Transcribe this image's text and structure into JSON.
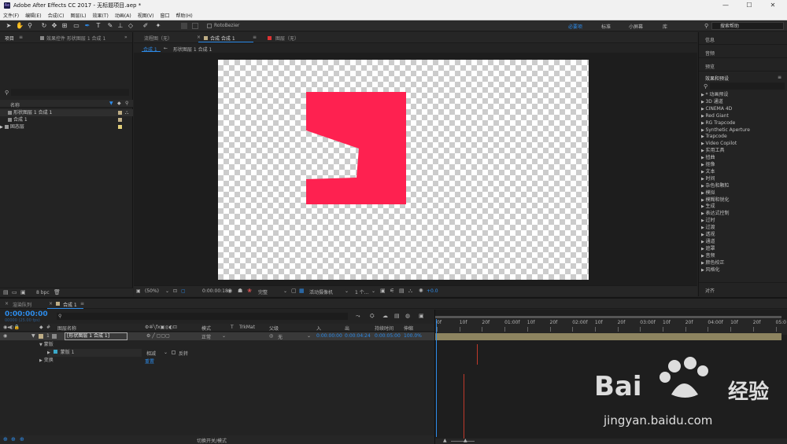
{
  "window": {
    "title": "Adobe After Effects CC 2017 - 无标题项目.aep *",
    "minimize": "—",
    "maximize": "☐",
    "close": "✕"
  },
  "menu": [
    "文件(F)",
    "编辑(E)",
    "合成(C)",
    "图层(L)",
    "效果(T)",
    "动画(A)",
    "视图(V)",
    "窗口",
    "帮助(H)"
  ],
  "toolbar": {
    "rotobezier": "RotoBezier",
    "workspaces": [
      "必要项",
      "标准",
      "小屏幕",
      "库"
    ],
    "search_placeholder": "搜索帮助"
  },
  "project": {
    "tab": "项目",
    "tab2": "效果控件 形状图层 1 合成 1",
    "col_name": "名称",
    "items": [
      "形状图层 1 合成 1",
      "合成 1",
      "固态层"
    ],
    "bpc": "8 bpc"
  },
  "viewer": {
    "tabs": [
      "流程图（无）",
      "合成 合成 1",
      "图层（无）"
    ],
    "breadcrumb": [
      "合成 1",
      "形状图层 1 合成 1"
    ],
    "zoom": "(50%)",
    "timecode": "0:00:00:18",
    "quality": "完整",
    "camera": "活动摄像机",
    "views": "1 个...",
    "exposure": "+0.0"
  },
  "right_panels": {
    "info": "信息",
    "audio": "音频",
    "preview": "预览",
    "effects": "效果和预设",
    "align": "对齐"
  },
  "effects_list": [
    "* 动画预设",
    "3D 通道",
    "CINEMA 4D",
    "Red Giant",
    "RG Trapcode",
    "Synthetic Aperture",
    "Trapcode",
    "Video Copilot",
    "实用工具",
    "扭曲",
    "抠像",
    "文本",
    "时间",
    "杂色和颗粒",
    "模拟",
    "模糊和锐化",
    "生成",
    "表达式控制",
    "过时",
    "过渡",
    "透视",
    "通道",
    "遮罩",
    "音频",
    "颜色校正",
    "风格化"
  ],
  "timeline": {
    "tab1": "渲染队列",
    "tab2": "合成 1",
    "timecode": "0:00:00:00",
    "fps": "00000 (25.00 fps)",
    "headers": [
      "图层名称",
      "模式",
      "T",
      "TrkMat",
      "父级",
      "入",
      "出",
      "持续时间",
      "伸缩"
    ],
    "layer_num": "1",
    "layer_name": "[形状图层 1 合成 1]",
    "mode": "正常",
    "parent": "无",
    "in": "0:00:00:00",
    "out": "0:00:04:24",
    "duration": "0:00:05:00",
    "stretch": "100.0%",
    "masks": "蒙版",
    "mask1": "蒙版 1",
    "mask_mode": "相减",
    "invert": "反转",
    "transform": "变换",
    "reset": "重置",
    "ruler": [
      "0f",
      "10f",
      "20f",
      "01:00f",
      "10f",
      "20f",
      "02:00f",
      "10f",
      "20f",
      "03:00f",
      "10f",
      "20f",
      "04:00f",
      "10f",
      "20f",
      "05:0"
    ],
    "toggle": "切换开关/模式"
  },
  "watermark": {
    "brand": "Bai",
    "brand2": "经验",
    "url": "jingyan.baidu.com"
  },
  "colors": {
    "accent": "#2d8ceb",
    "shape": "#fe2150",
    "clip": "#8d8460"
  }
}
